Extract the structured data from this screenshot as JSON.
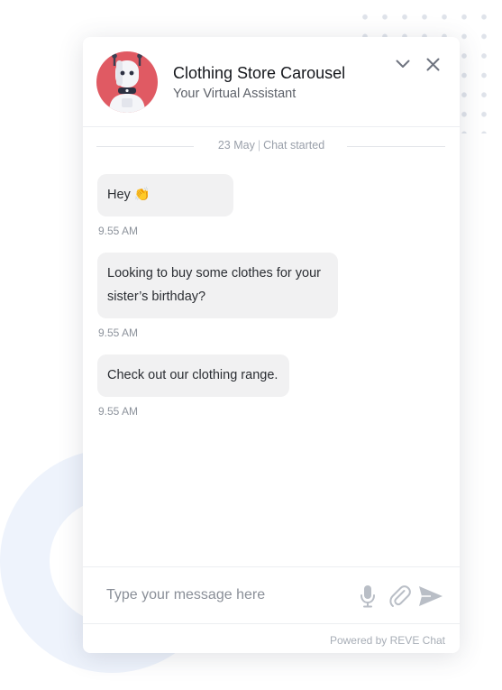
{
  "header": {
    "title": "Clothing Store Carousel",
    "subtitle": "Your Virtual Assistant",
    "avatar_icon": "robot-icon",
    "minimize_icon": "chevron-down-icon",
    "close_icon": "close-icon"
  },
  "chat": {
    "date": "23 May",
    "separator": "|",
    "status": "Chat started",
    "messages": [
      {
        "text": "Hey 👏",
        "time": "9.55 AM"
      },
      {
        "text": "Looking to buy some clothes for your sister’s birthday?",
        "time": "9.55 AM"
      },
      {
        "text": "Check out our clothing range.",
        "time": "9.55 AM"
      }
    ]
  },
  "composer": {
    "placeholder": "Type your message here",
    "mic_icon": "microphone-icon",
    "attach_icon": "paperclip-icon",
    "send_icon": "send-icon"
  },
  "footer": {
    "powered_by": "Powered by REVE Chat"
  },
  "colors": {
    "avatar_bg": "#e05a63",
    "bubble_bg": "#f1f1f2",
    "icon_gray": "#b9bec6",
    "deco_blue": "#eef3fc"
  }
}
